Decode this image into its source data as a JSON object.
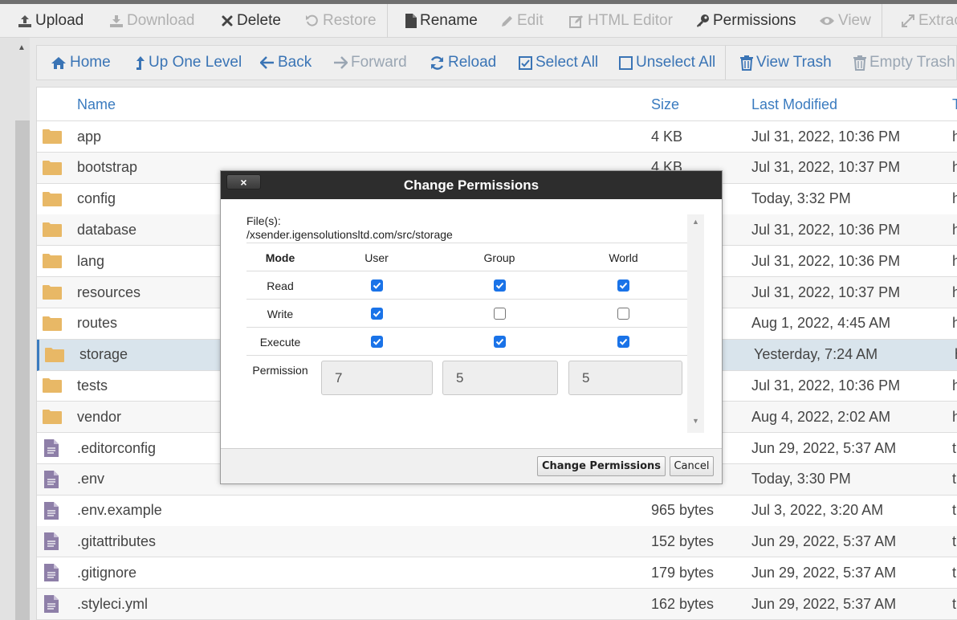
{
  "toolbar": {
    "upload": "Upload",
    "download": "Download",
    "delete": "Delete",
    "restore": "Restore",
    "rename": "Rename",
    "edit": "Edit",
    "html_editor": "HTML Editor",
    "permissions": "Permissions",
    "view": "View",
    "extract": "Extract"
  },
  "nav": {
    "home": "Home",
    "up_one_level": "Up One Level",
    "back": "Back",
    "forward": "Forward",
    "reload": "Reload",
    "select_all": "Select All",
    "unselect_all": "Unselect All",
    "view_trash": "View Trash",
    "empty_trash": "Empty Trash"
  },
  "table": {
    "headers": {
      "name": "Name",
      "size": "Size",
      "last_modified": "Last Modified",
      "type": "T"
    },
    "rows": [
      {
        "icon": "folder-icon",
        "name": "app",
        "size": "4 KB",
        "modified": "Jul 31, 2022, 10:36 PM",
        "type": "h"
      },
      {
        "icon": "folder-icon",
        "name": "bootstrap",
        "size": "4 KB",
        "modified": "Jul 31, 2022, 10:37 PM",
        "type": "h"
      },
      {
        "icon": "folder-icon",
        "name": "config",
        "size": "",
        "modified": "Today, 3:32 PM",
        "type": "h"
      },
      {
        "icon": "folder-icon",
        "name": "database",
        "size": "",
        "modified": "Jul 31, 2022, 10:36 PM",
        "type": "h"
      },
      {
        "icon": "folder-icon",
        "name": "lang",
        "size": "",
        "modified": "Jul 31, 2022, 10:36 PM",
        "type": "h"
      },
      {
        "icon": "folder-icon",
        "name": "resources",
        "size": "",
        "modified": "Jul 31, 2022, 10:37 PM",
        "type": "h"
      },
      {
        "icon": "folder-icon",
        "name": "routes",
        "size": "",
        "modified": "Aug 1, 2022, 4:45 AM",
        "type": "h"
      },
      {
        "icon": "folder-icon",
        "name": "storage",
        "size": "",
        "modified": "Yesterday, 7:24 AM",
        "type": "h",
        "selected": true
      },
      {
        "icon": "folder-icon",
        "name": "tests",
        "size": "",
        "modified": "Jul 31, 2022, 10:36 PM",
        "type": "h"
      },
      {
        "icon": "folder-icon",
        "name": "vendor",
        "size": "",
        "modified": "Aug 4, 2022, 2:02 AM",
        "type": "h"
      },
      {
        "icon": "file-icon",
        "name": ".editorconfig",
        "size": "",
        "modified": "Jun 29, 2022, 5:37 AM",
        "type": "t"
      },
      {
        "icon": "file-icon",
        "name": ".env",
        "size": "",
        "modified": "Today, 3:30 PM",
        "type": "t"
      },
      {
        "icon": "file-icon",
        "name": ".env.example",
        "size": "965 bytes",
        "modified": "Jul 3, 2022, 3:20 AM",
        "type": "t"
      },
      {
        "icon": "file-icon",
        "name": ".gitattributes",
        "size": "152 bytes",
        "modified": "Jun 29, 2022, 5:37 AM",
        "type": "t"
      },
      {
        "icon": "file-icon",
        "name": ".gitignore",
        "size": "179 bytes",
        "modified": "Jun 29, 2022, 5:37 AM",
        "type": "t"
      },
      {
        "icon": "file-icon",
        "name": ".styleci.yml",
        "size": "162 bytes",
        "modified": "Jun 29, 2022, 5:37 AM",
        "type": "t"
      }
    ]
  },
  "dialog": {
    "title": "Change Permissions",
    "close_label": "×",
    "files_label": "File(s):",
    "files_path": "/xsender.igensolutionsltd.com/src/storage",
    "headers": {
      "mode": "Mode",
      "user": "User",
      "group": "Group",
      "world": "World"
    },
    "modes": [
      {
        "label": "Read",
        "user": true,
        "group": true,
        "world": true
      },
      {
        "label": "Write",
        "user": true,
        "group": false,
        "world": false
      },
      {
        "label": "Execute",
        "user": true,
        "group": true,
        "world": true
      }
    ],
    "permission_label": "Permission",
    "permission_values": {
      "user": "7",
      "group": "5",
      "world": "5"
    },
    "change_button": "Change Permissions",
    "cancel_button": "Cancel"
  },
  "colors": {
    "accent": "#3a7bbf",
    "folder": "#e8b866",
    "file": "#8e7fa8",
    "checkbox": "#1a73e8",
    "dialog_title_bg": "#2d2d2d"
  }
}
